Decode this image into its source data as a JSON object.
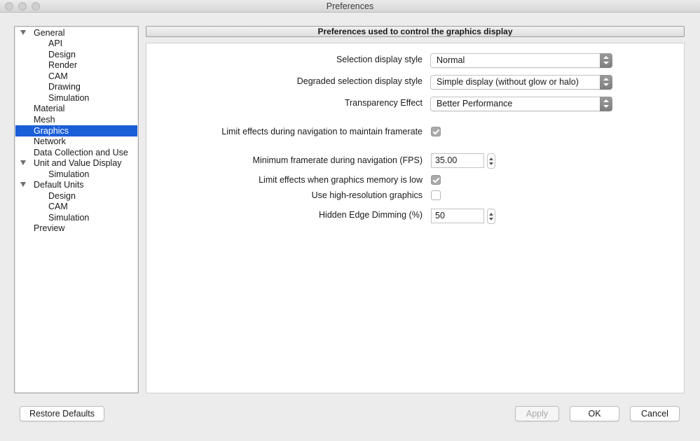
{
  "window": {
    "title": "Preferences"
  },
  "sidebar": {
    "items": [
      {
        "label": "General",
        "expanded": true,
        "level": 0
      },
      {
        "label": "API",
        "level": 1
      },
      {
        "label": "Design",
        "level": 1
      },
      {
        "label": "Render",
        "level": 1
      },
      {
        "label": "CAM",
        "level": 1
      },
      {
        "label": "Drawing",
        "level": 1
      },
      {
        "label": "Simulation",
        "level": 1
      },
      {
        "label": "Material",
        "level": 0
      },
      {
        "label": "Mesh",
        "level": 0
      },
      {
        "label": "Graphics",
        "level": 0,
        "selected": true
      },
      {
        "label": "Network",
        "level": 0
      },
      {
        "label": "Data Collection and Use",
        "level": 0
      },
      {
        "label": "Unit and Value Display",
        "expanded": true,
        "level": 0
      },
      {
        "label": "Simulation",
        "level": 1
      },
      {
        "label": "Default Units",
        "expanded": true,
        "level": 0
      },
      {
        "label": "Design",
        "level": 1
      },
      {
        "label": "CAM",
        "level": 1
      },
      {
        "label": "Simulation",
        "level": 1
      },
      {
        "label": "Preview",
        "level": 0
      }
    ],
    "selected_color": "#1b5ed8"
  },
  "panel": {
    "header": "Preferences used to control the graphics display",
    "selection_style": {
      "label": "Selection display style",
      "value": "Normal"
    },
    "degraded_style": {
      "label": "Degraded selection display style",
      "value": "Simple display (without glow or halo)"
    },
    "transparency": {
      "label": "Transparency Effect",
      "value": "Better Performance"
    },
    "limit_nav": {
      "label": "Limit effects during navigation to maintain framerate",
      "checked": true
    },
    "min_framerate": {
      "label": "Minimum framerate during navigation (FPS)",
      "value": "35.00"
    },
    "limit_memory": {
      "label": "Limit effects when graphics memory is low",
      "checked": true
    },
    "hi_res": {
      "label": "Use high-resolution graphics",
      "checked": false
    },
    "edge_dimming": {
      "label": "Hidden Edge Dimming (%)",
      "value": "50"
    }
  },
  "footer": {
    "restore_label": "Restore Defaults",
    "apply_label": "Apply",
    "ok_label": "OK",
    "cancel_label": "Cancel"
  }
}
